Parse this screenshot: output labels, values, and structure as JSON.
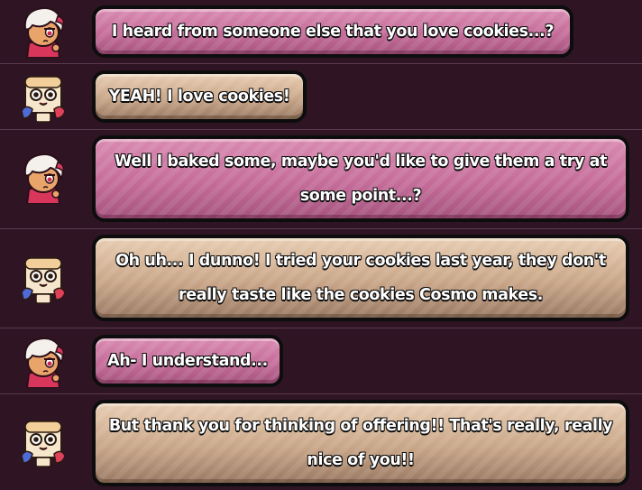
{
  "messages": [
    {
      "speaker_icon": "white-haired-cookie-icon",
      "color": "pink",
      "text": "I heard from someone else that you love cookies...?"
    },
    {
      "speaker_icon": "cream-puff-cookie-icon",
      "color": "tan",
      "text": "YEAH! I love cookies!"
    },
    {
      "speaker_icon": "white-haired-cookie-icon",
      "color": "pink",
      "text": "Well I baked some, maybe you'd like to give them a try at some point...?"
    },
    {
      "speaker_icon": "cream-puff-cookie-icon",
      "color": "tan",
      "text": "Oh uh... I dunno! I tried your cookies last year, they don't really taste like the cookies Cosmo makes."
    },
    {
      "speaker_icon": "white-haired-cookie-icon",
      "color": "pink",
      "text": "Ah- I understand..."
    },
    {
      "speaker_icon": "cream-puff-cookie-icon",
      "color": "tan",
      "text": "But thank you for thinking of offering!! That's really, really nice of you!!"
    }
  ],
  "colors": {
    "background": "#2f1524",
    "divider": "#5a3a4c",
    "pink_bubble": "#c56d9a",
    "tan_bubble": "#c9a688",
    "outline": "#0d0d0d"
  }
}
